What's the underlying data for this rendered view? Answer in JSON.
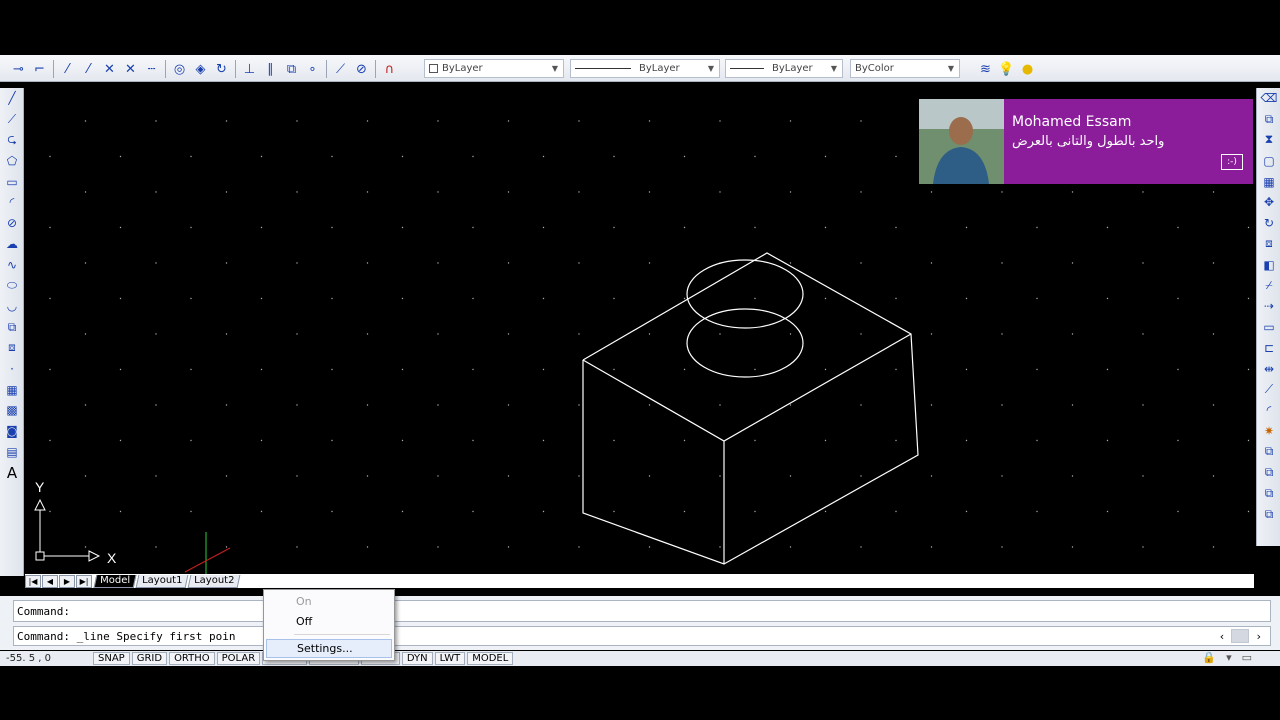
{
  "toolbar": {
    "draw_icons": [
      "line-icon",
      "xline-icon",
      "pline-icon",
      "polygon-icon",
      "rectangle-icon",
      "snap-tracking-icon",
      "endpoint-icon",
      "midpoint-icon",
      "intersection-icon",
      "apparent-intersection-icon",
      "extension-icon"
    ],
    "snap_icons": [
      "center-icon",
      "quadrant-icon",
      "tangent-icon",
      "perpendicular-icon",
      "parallel-icon",
      "insert-icon",
      "node-icon",
      "nearest-icon",
      "none-icon",
      "osnap-settings-icon"
    ],
    "layer_combo": "ByLayer",
    "linetype_combo": "ByLayer",
    "lineweight_combo": "ByLayer",
    "color_combo": "ByColor"
  },
  "left_toolbar": [
    "line-icon",
    "construction-line-icon",
    "polyline-icon",
    "polygon-icon",
    "rectangle-icon",
    "arc-icon",
    "circle-icon",
    "revision-cloud-icon",
    "spline-icon",
    "ellipse-icon",
    "ellipse-arc-icon",
    "insert-block-icon",
    "make-block-icon",
    "point-icon",
    "hatch-icon",
    "gradient-icon",
    "region-icon",
    "table-icon",
    "multiline-text-icon"
  ],
  "right_toolbar": [
    "erase-icon",
    "copy-icon",
    "mirror-icon",
    "offset-icon",
    "array-icon",
    "move-icon",
    "rotate-icon",
    "scale-icon",
    "stretch-icon",
    "trim-icon",
    "extend-icon",
    "break-at-point-icon",
    "break-icon",
    "join-icon",
    "chamfer-icon",
    "fillet-icon",
    "explode-icon",
    "draworder-front-icon",
    "draworder-back-icon",
    "draworder-above-icon",
    "draworder-below-icon"
  ],
  "ucs": {
    "x_label": "X",
    "y_label": "Y"
  },
  "tabs": {
    "model": "Model",
    "layout1": "Layout1",
    "layout2": "Layout2"
  },
  "command": {
    "history": "Command:",
    "current": "Command: _line Specify first poin"
  },
  "context_menu": {
    "on": "On",
    "off": "Off",
    "settings": "Settings..."
  },
  "status": {
    "coords": "-55. 5 , 0",
    "buttons": [
      "SNAP",
      "GRID",
      "ORTHO",
      "POLAR",
      "OSNAP",
      "OTRACK",
      "DUCS",
      "DYN",
      "LWT",
      "MODEL"
    ]
  },
  "notification": {
    "name": "Mohamed Essam",
    "message": "واحد بالطول والتانى بالعرض",
    "icon": ":-)"
  }
}
